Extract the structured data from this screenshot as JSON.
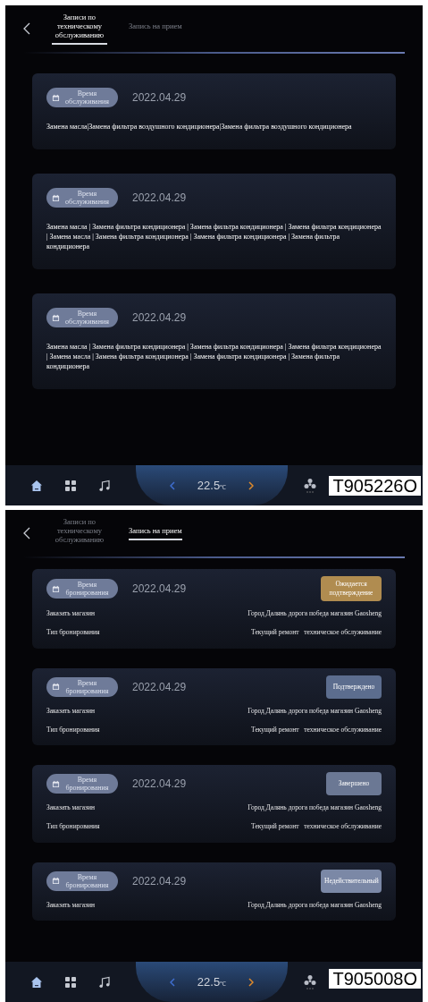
{
  "screens": [
    {
      "tabs": [
        {
          "label": "Записи по техническому обслуживанию",
          "selected": true
        },
        {
          "label": "Запись на прием",
          "selected": false
        }
      ],
      "cards": [
        {
          "kind": "service",
          "badge": "Время обслуживания",
          "date": "2022.04.29",
          "text": "Замена масла|Замена фильтра воздушного кондиционера|Замена фильтра воздушного кондиционера"
        },
        {
          "kind": "service",
          "badge": "Время обслуживания",
          "date": "2022.04.29",
          "text": "Замена масла | Замена фильтра кондиционера | Замена фильтра кондиционера | Замена фильтра кондиционера | Замена масла | Замена фильтра кондиционера | Замена фильтра кондиционера | Замена фильтра кондиционера"
        },
        {
          "kind": "service",
          "badge": "Время обслуживания",
          "date": "2022.04.29",
          "text": "Замена масла | Замена фильтра кондиционера | Замена фильтра кондиционера | Замена фильтра кондиционера | Замена масла | Замена фильтра кондиционера | Замена фильтра кондиционера | Замена фильтра кондиционера"
        }
      ],
      "bottom_bar": {
        "temperature": "22.5",
        "unit": "℃"
      },
      "figure_label": "T905226O"
    },
    {
      "tabs": [
        {
          "label": "Записи по техническому обслуживанию",
          "selected": false
        },
        {
          "label": "Запись на прием",
          "selected": true
        }
      ],
      "cards": [
        {
          "kind": "booking",
          "badge": "Время бронирования",
          "date": "2022.04.29",
          "status": {
            "label": "Ожидается подтверждение",
            "color": "#b08c50"
          },
          "rows": [
            {
              "label": "Заказать магазин",
              "value": "Город Далянь дорога победа магазин Gaosheng"
            },
            {
              "label": "Тип бронирования",
              "value": "Текущий ремонт   техническое обслуживание"
            }
          ]
        },
        {
          "kind": "booking",
          "badge": "Время бронирования",
          "date": "2022.04.29",
          "status": {
            "label": "Подтверждено",
            "color": "#5c6d8e"
          },
          "rows": [
            {
              "label": "Заказать магазин",
              "value": "Город Далянь дорога победа магазин Gaosheng"
            },
            {
              "label": "Тип бронирования",
              "value": "Текущий ремонт   техническое обслуживание"
            }
          ]
        },
        {
          "kind": "booking",
          "badge": "Время бронирования",
          "date": "2022.04.29",
          "status": {
            "label": "Завершено",
            "color": "#6b7894"
          },
          "rows": [
            {
              "label": "Заказать магазин",
              "value": "Город Далянь дорога победа магазин Gaosheng"
            },
            {
              "label": "Тип бронирования",
              "value": "Текущий ремонт   техническое обслуживание"
            }
          ]
        },
        {
          "kind": "booking",
          "badge": "Время бронирования",
          "date": "2022.04.29",
          "status": {
            "label": "Недействительный",
            "color": "#7b88a6"
          },
          "rows": [
            {
              "label": "Заказать магазин",
              "value": "Город Далянь дорога победа магазин Gaosheng"
            }
          ]
        }
      ],
      "bottom_bar": {
        "temperature": "22.5",
        "unit": "℃"
      },
      "figure_label": "T905008O"
    }
  ]
}
